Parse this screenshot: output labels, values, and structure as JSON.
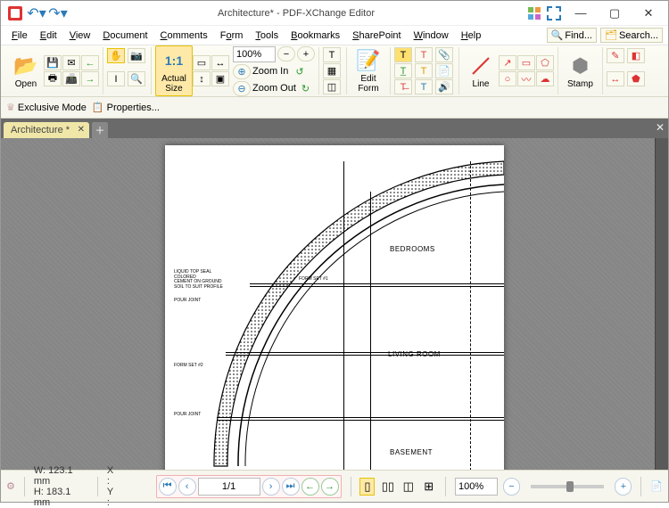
{
  "title": "Architecture* - PDF-XChange Editor",
  "titlebar": {
    "undo": "↶",
    "redo": "↷"
  },
  "menus": [
    "File",
    "Edit",
    "View",
    "Document",
    "Comments",
    "Form",
    "Tools",
    "Bookmarks",
    "SharePoint",
    "Window",
    "Help"
  ],
  "quick": {
    "find": "Find...",
    "search": "Search..."
  },
  "toolbar": {
    "open": "Open",
    "actual_size": "Actual\nSize",
    "zoom_in": "Zoom In",
    "zoom_out": "Zoom Out",
    "zoom_value": "100%",
    "edit_form": "Edit\nForm",
    "line": "Line",
    "stamp": "Stamp"
  },
  "secondbar": {
    "exclusive": "Exclusive Mode",
    "properties": "Properties..."
  },
  "tab": {
    "name": "Architecture *"
  },
  "drawing": {
    "rooms": [
      "BEDROOMS",
      "LIVING ROOM",
      "BASEMENT"
    ],
    "notes": [
      "FORM SET #1",
      "POUR JOINT",
      "FORM SET #2",
      "POUR JOINT"
    ]
  },
  "status": {
    "w": "W: 123.1 mm",
    "h": "H: 183.1 mm",
    "x": "X :",
    "y": "Y :",
    "page": "1/1",
    "zoom": "100%"
  }
}
